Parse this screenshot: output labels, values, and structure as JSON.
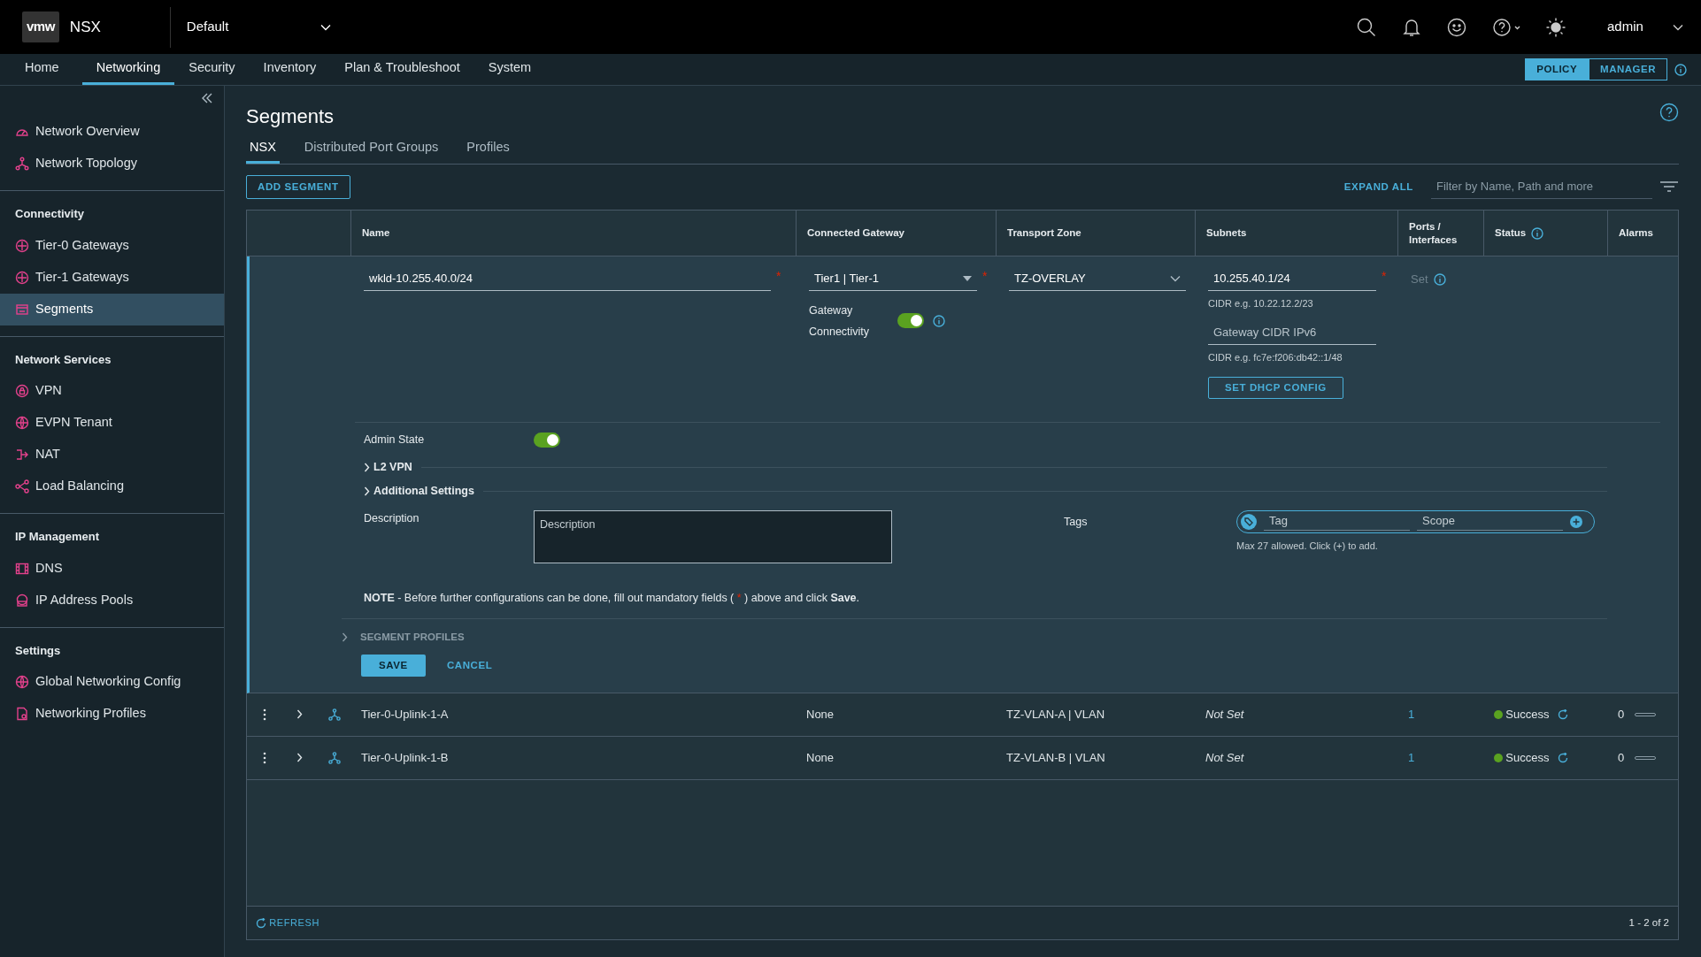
{
  "header": {
    "logo": "vmw",
    "product": "NSX",
    "project": "Default",
    "user": "admin"
  },
  "nav": {
    "tabs": [
      {
        "label": "Home",
        "selected": false
      },
      {
        "label": "Networking",
        "selected": true
      },
      {
        "label": "Security",
        "selected": false
      },
      {
        "label": "Inventory",
        "selected": false
      },
      {
        "label": "Plan & Troubleshoot",
        "selected": false
      },
      {
        "label": "System",
        "selected": false
      }
    ],
    "modes": [
      {
        "label": "POLICY",
        "selected": true
      },
      {
        "label": "MANAGER",
        "selected": false
      }
    ]
  },
  "sidebar": {
    "sections": [
      {
        "items": [
          {
            "label": "Network Overview",
            "selected": false
          },
          {
            "label": "Network Topology",
            "selected": false
          }
        ]
      },
      {
        "heading": "Connectivity",
        "items": [
          {
            "label": "Tier-0 Gateways",
            "selected": false
          },
          {
            "label": "Tier-1 Gateways",
            "selected": false
          },
          {
            "label": "Segments",
            "selected": true
          }
        ]
      },
      {
        "heading": "Network Services",
        "items": [
          {
            "label": "VPN",
            "selected": false
          },
          {
            "label": "EVPN Tenant",
            "selected": false
          },
          {
            "label": "NAT",
            "selected": false
          },
          {
            "label": "Load Balancing",
            "selected": false
          }
        ]
      },
      {
        "heading": "IP Management",
        "items": [
          {
            "label": "DNS",
            "selected": false
          },
          {
            "label": "IP Address Pools",
            "selected": false
          }
        ]
      },
      {
        "heading": "Settings",
        "items": [
          {
            "label": "Global Networking Config",
            "selected": false
          },
          {
            "label": "Networking Profiles",
            "selected": false
          }
        ]
      }
    ]
  },
  "page": {
    "title": "Segments",
    "tabs": [
      {
        "label": "NSX",
        "selected": true
      },
      {
        "label": "Distributed Port Groups",
        "selected": false
      },
      {
        "label": "Profiles",
        "selected": false
      }
    ],
    "add_button": "ADD SEGMENT",
    "expand_all": "EXPAND ALL",
    "filter": {
      "placeholder": "Filter by Name, Path and more"
    }
  },
  "table": {
    "columns": [
      "Name",
      "Connected Gateway",
      "Transport Zone",
      "Subnets",
      "Ports / Interfaces",
      "Status",
      "Alarms"
    ],
    "editor": {
      "name": {
        "value": "wkld-10.255.40.0/24",
        "mark": "*"
      },
      "gateway": {
        "value": "Tier1 | Tier-1",
        "mark": "*"
      },
      "gateway_connectivity": {
        "label": "Gateway Connectivity",
        "on": true
      },
      "transport_zone": {
        "value": "TZ-OVERLAY"
      },
      "subnet": {
        "value": "10.255.40.1/24",
        "mark": "*",
        "hint": "CIDR e.g. 10.22.12.2/23"
      },
      "ipv6": {
        "placeholder": "Gateway CIDR IPv6",
        "hint": "CIDR e.g. fc7e:f206:db42::1/48"
      },
      "dhcp_button": "SET DHCP CONFIG",
      "ports": "Set",
      "admin_state": {
        "label": "Admin State",
        "on": true
      },
      "sections": [
        {
          "label": "L2 VPN",
          "expanded": false
        },
        {
          "label": "Additional Settings",
          "expanded": false
        }
      ],
      "description": {
        "label": "Description",
        "placeholder": "Description"
      },
      "tags": {
        "label": "Tags",
        "tag_placeholder": "Tag",
        "scope_placeholder": "Scope",
        "hint": "Max 27 allowed. Click (+) to add."
      },
      "note_before": "**NOTE** - Before further configurations can be done, fill out mandatory fields ( ",
      "note_mark": "*",
      "note_after": " ) above and click **Save**.",
      "profiles": {
        "label": "SEGMENT PROFILES",
        "expanded": false
      },
      "save": "SAVE",
      "cancel": "CANCEL"
    },
    "rows": [
      {
        "name": "Tier-0-Uplink-1-A",
        "gateway": "None",
        "transport_zone": "TZ-VLAN-A | VLAN",
        "subnets": "Not Set",
        "ports": "1",
        "status": "Success",
        "color": "#5aa220",
        "alarms": "0"
      },
      {
        "name": "Tier-0-Uplink-1-B",
        "gateway": "None",
        "transport_zone": "TZ-VLAN-B | VLAN",
        "subnets": "Not Set",
        "ports": "1",
        "status": "Success",
        "color": "#5aa220",
        "alarms": "0"
      }
    ],
    "footer": {
      "refresh": "REFRESH",
      "count": "1 - 2 of 2"
    }
  }
}
